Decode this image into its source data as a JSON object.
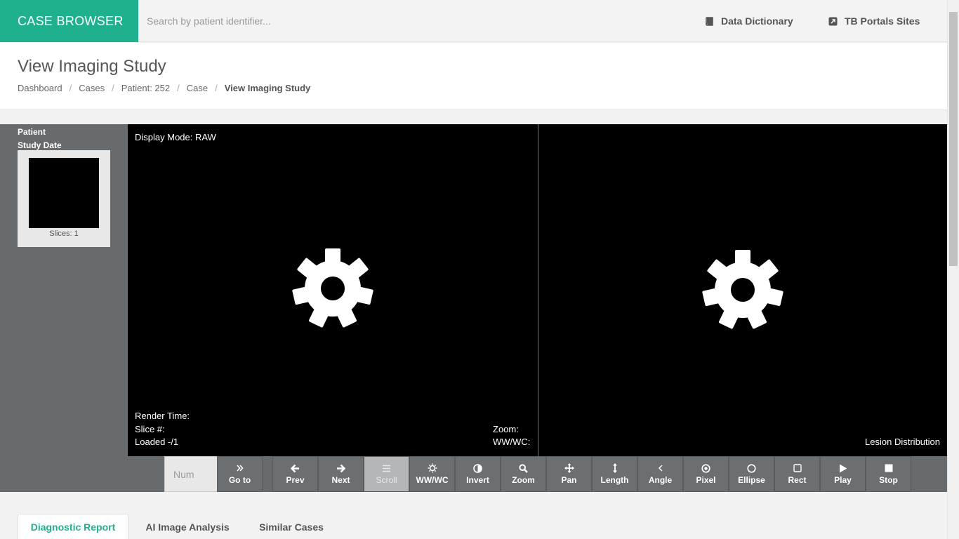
{
  "topbar": {
    "brand": "CASE BROWSER",
    "search_placeholder": "Search by patient identifier...",
    "links": [
      {
        "label": "Data Dictionary",
        "icon": "book-icon"
      },
      {
        "label": "TB Portals Sites",
        "icon": "external-link-icon"
      }
    ]
  },
  "header": {
    "title": "View Imaging Study",
    "breadcrumbs": [
      "Dashboard",
      "Cases",
      "Patient: 252",
      "Case",
      "View Imaging Study"
    ],
    "separator": "/"
  },
  "sidebar": {
    "patient_label": "Patient",
    "study_date_label": "Study Date",
    "thumbnail_caption": "Slices: 1"
  },
  "viewer": {
    "left": {
      "display_mode": "Display Mode: RAW",
      "render_time": "Render Time:",
      "slice": "Slice #:",
      "loaded": "Loaded -/1",
      "zoom": "Zoom:",
      "wwwc": "WW/WC:"
    },
    "right": {
      "lesion_distribution": "Lesion Distribution"
    }
  },
  "toolbar": {
    "num_placeholder": "Num",
    "goto": {
      "label": "Go to",
      "icon": "double-chevron-right-icon"
    },
    "tools": [
      {
        "label": "Prev",
        "icon": "arrow-left-icon"
      },
      {
        "label": "Next",
        "icon": "arrow-right-icon"
      },
      {
        "label": "Scroll",
        "icon": "bars-icon",
        "active": true
      },
      {
        "label": "WW/WC",
        "icon": "sun-icon"
      },
      {
        "label": "Invert",
        "icon": "adjust-icon"
      },
      {
        "label": "Zoom",
        "icon": "magnifier-icon"
      },
      {
        "label": "Pan",
        "icon": "move-icon"
      },
      {
        "label": "Length",
        "icon": "vertical-arrows-icon"
      },
      {
        "label": "Angle",
        "icon": "chevron-left-icon"
      },
      {
        "label": "Pixel",
        "icon": "dot-circle-icon"
      },
      {
        "label": "Ellipse",
        "icon": "circle-icon"
      },
      {
        "label": "Rect",
        "icon": "square-icon"
      },
      {
        "label": "Play",
        "icon": "play-icon"
      },
      {
        "label": "Stop",
        "icon": "stop-icon"
      }
    ]
  },
  "tabs": [
    {
      "label": "Diagnostic Report",
      "active": true
    },
    {
      "label": "AI Image Analysis"
    },
    {
      "label": "Similar Cases"
    }
  ],
  "colors": {
    "brand": "#1fb08e",
    "viewer_bg": "#000000",
    "panel_bg": "#676b6e"
  }
}
